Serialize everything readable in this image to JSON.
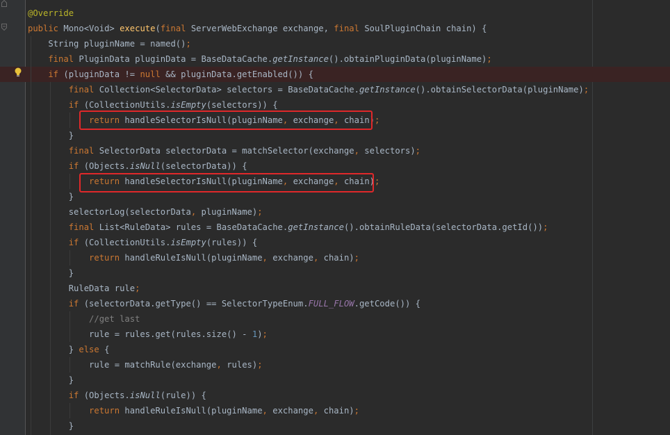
{
  "colors": {
    "background": "#2b2b2b",
    "gutter": "#313335",
    "keyword": "#cc7832",
    "annotation": "#bbb529",
    "method": "#ffc66d",
    "constant": "#9876aa",
    "number": "#6897bb",
    "comment": "#808080",
    "text": "#a9b7c6",
    "highlight_box": "#e0282a"
  },
  "lines": [
    {
      "tokens": [
        [
          "ann",
          "@Override"
        ]
      ]
    },
    {
      "tokens": [
        [
          "kw",
          "public "
        ],
        [
          "t",
          "Mono<Void> "
        ],
        [
          "fn",
          "execute"
        ],
        [
          "t",
          "("
        ],
        [
          "kw",
          "final "
        ],
        [
          "t",
          "ServerWebExchange exchange, "
        ],
        [
          "kw",
          "final "
        ],
        [
          "t",
          "SoulPluginChain chain) {"
        ]
      ]
    },
    {
      "tokens": [
        [
          "t",
          "    String pluginName = named()"
        ],
        [
          "kw",
          ";"
        ]
      ]
    },
    {
      "tokens": [
        [
          "kw",
          "    final "
        ],
        [
          "t",
          "PluginData pluginData = BaseDataCache."
        ],
        [
          "st",
          "getInstance"
        ],
        [
          "t",
          "().obtainPluginData(pluginName)"
        ],
        [
          "kw",
          ";"
        ]
      ]
    },
    {
      "tokens": [
        [
          "kw",
          "    if "
        ],
        [
          "t",
          "(pluginData != "
        ],
        [
          "kw",
          "null "
        ],
        [
          "t",
          "&& pluginData.getEnabled()) {"
        ]
      ]
    },
    {
      "tokens": [
        [
          "kw",
          "        final "
        ],
        [
          "t",
          "Collection<SelectorData> selectors = BaseDataCache."
        ],
        [
          "st",
          "getInstance"
        ],
        [
          "t",
          "().obtainSelectorData(pluginName)"
        ],
        [
          "kw",
          ";"
        ]
      ]
    },
    {
      "tokens": [
        [
          "kw",
          "        if "
        ],
        [
          "t",
          "(CollectionUtils."
        ],
        [
          "st",
          "isEmpty"
        ],
        [
          "t",
          "(selectors)) {"
        ]
      ]
    },
    {
      "tokens": [
        [
          "kw",
          "            return "
        ],
        [
          "t",
          "handleSelectorIsNull(pluginName"
        ],
        [
          "kw",
          ", "
        ],
        [
          "t",
          "exchange"
        ],
        [
          "kw",
          ", "
        ],
        [
          "t",
          "chain)"
        ],
        [
          "kw",
          ";"
        ]
      ]
    },
    {
      "tokens": [
        [
          "t",
          "        }"
        ]
      ]
    },
    {
      "tokens": [
        [
          "kw",
          "        final "
        ],
        [
          "t",
          "SelectorData selectorData = matchSelector(exchange"
        ],
        [
          "kw",
          ", "
        ],
        [
          "t",
          "selectors)"
        ],
        [
          "kw",
          ";"
        ]
      ]
    },
    {
      "tokens": [
        [
          "kw",
          "        if "
        ],
        [
          "t",
          "(Objects."
        ],
        [
          "st",
          "isNull"
        ],
        [
          "t",
          "(selectorData)) {"
        ]
      ]
    },
    {
      "tokens": [
        [
          "kw",
          "            return "
        ],
        [
          "t",
          "handleSelectorIsNull(pluginName"
        ],
        [
          "kw",
          ", "
        ],
        [
          "t",
          "exchange"
        ],
        [
          "kw",
          ", "
        ],
        [
          "t",
          "chain)"
        ],
        [
          "kw",
          ";"
        ]
      ]
    },
    {
      "tokens": [
        [
          "t",
          "        }"
        ]
      ]
    },
    {
      "tokens": [
        [
          "t",
          "        selectorLog(selectorData"
        ],
        [
          "kw",
          ", "
        ],
        [
          "t",
          "pluginName)"
        ],
        [
          "kw",
          ";"
        ]
      ]
    },
    {
      "tokens": [
        [
          "kw",
          "        final "
        ],
        [
          "t",
          "List<RuleData> rules = BaseDataCache."
        ],
        [
          "st",
          "getInstance"
        ],
        [
          "t",
          "().obtainRuleData(selectorData.getId())"
        ],
        [
          "kw",
          ";"
        ]
      ]
    },
    {
      "tokens": [
        [
          "kw",
          "        if "
        ],
        [
          "t",
          "(CollectionUtils."
        ],
        [
          "st",
          "isEmpty"
        ],
        [
          "t",
          "(rules)) {"
        ]
      ]
    },
    {
      "tokens": [
        [
          "kw",
          "            return "
        ],
        [
          "t",
          "handleRuleIsNull(pluginName"
        ],
        [
          "kw",
          ", "
        ],
        [
          "t",
          "exchange"
        ],
        [
          "kw",
          ", "
        ],
        [
          "t",
          "chain)"
        ],
        [
          "kw",
          ";"
        ]
      ]
    },
    {
      "tokens": [
        [
          "t",
          "        }"
        ]
      ]
    },
    {
      "tokens": [
        [
          "t",
          "        RuleData rule"
        ],
        [
          "kw",
          ";"
        ]
      ]
    },
    {
      "tokens": [
        [
          "kw",
          "        if "
        ],
        [
          "t",
          "(selectorData.getType() == SelectorTypeEnum."
        ],
        [
          "cst",
          "FULL_FLOW"
        ],
        [
          "t",
          ".getCode()) {"
        ]
      ]
    },
    {
      "tokens": [
        [
          "cm",
          "            //get last"
        ]
      ]
    },
    {
      "tokens": [
        [
          "t",
          "            rule = rules.get(rules.size() - "
        ],
        [
          "num",
          "1"
        ],
        [
          "t",
          ")"
        ],
        [
          "kw",
          ";"
        ]
      ]
    },
    {
      "tokens": [
        [
          "t",
          "        } "
        ],
        [
          "kw",
          "else "
        ],
        [
          "t",
          "{"
        ]
      ]
    },
    {
      "tokens": [
        [
          "t",
          "            rule = matchRule(exchange"
        ],
        [
          "kw",
          ", "
        ],
        [
          "t",
          "rules)"
        ],
        [
          "kw",
          ";"
        ]
      ]
    },
    {
      "tokens": [
        [
          "t",
          "        }"
        ]
      ]
    },
    {
      "tokens": [
        [
          "kw",
          "        if "
        ],
        [
          "t",
          "(Objects."
        ],
        [
          "st",
          "isNull"
        ],
        [
          "t",
          "(rule)) {"
        ]
      ]
    },
    {
      "tokens": [
        [
          "kw",
          "            return "
        ],
        [
          "t",
          "handleRuleIsNull(pluginName"
        ],
        [
          "kw",
          ", "
        ],
        [
          "t",
          "exchange"
        ],
        [
          "kw",
          ", "
        ],
        [
          "t",
          "chain)"
        ],
        [
          "kw",
          ";"
        ]
      ]
    },
    {
      "tokens": [
        [
          "t",
          "        }"
        ]
      ]
    }
  ],
  "highlighted_line": 4,
  "boxed_lines": [
    7,
    11
  ],
  "icons": {
    "intention": "lightbulb-icon",
    "fold": "fold-marker-icon"
  }
}
